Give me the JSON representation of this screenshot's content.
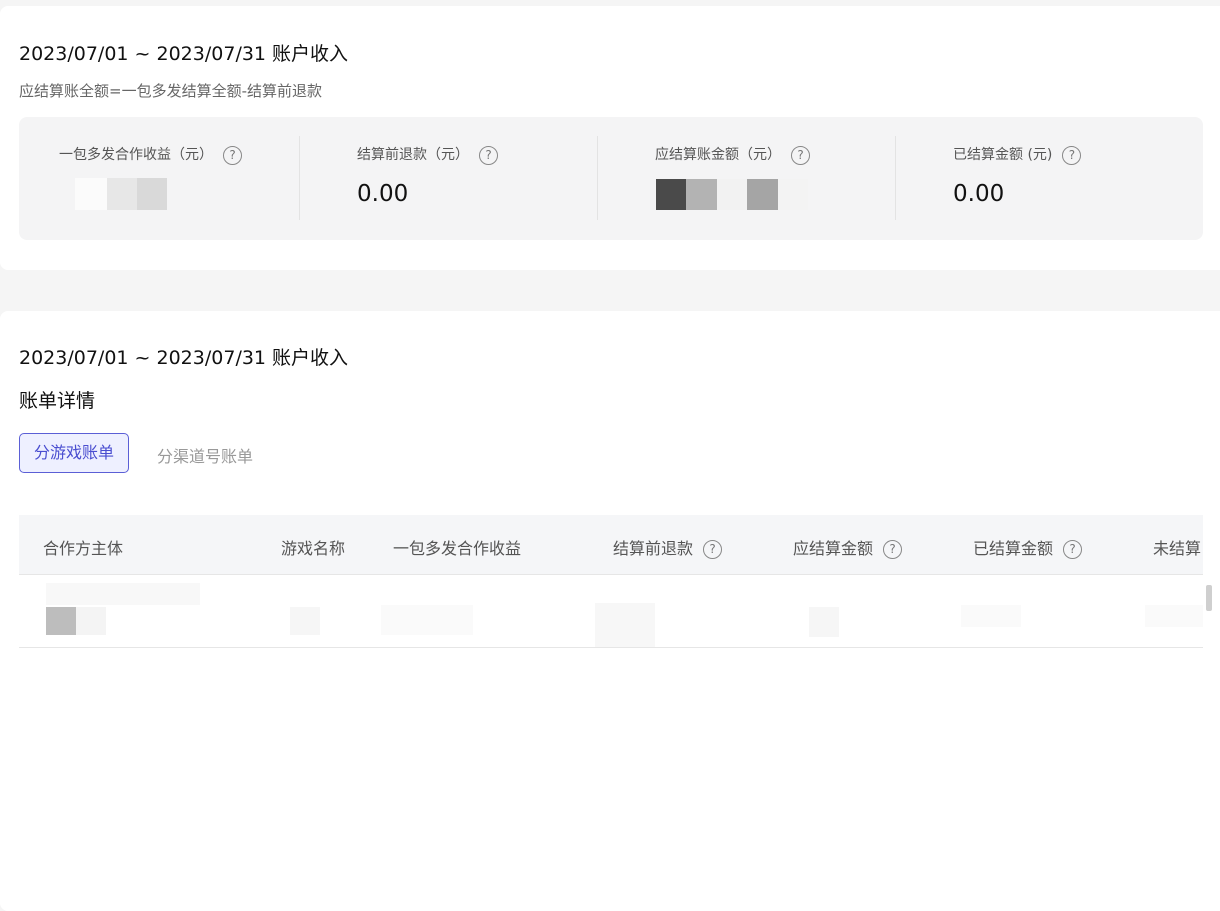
{
  "summary": {
    "title": "2023/07/01 ~ 2023/07/31 账户收入",
    "formula": "应结算账全额=一包多发结算全额-结算前退款",
    "stats": [
      {
        "label": "一包多发合作收益（元）",
        "value": ""
      },
      {
        "label": "结算前退款（元）",
        "value": "0.00"
      },
      {
        "label": "应结算账金额（元）",
        "value": ""
      },
      {
        "label": "已结算金额 (元)",
        "value": "0.00"
      }
    ]
  },
  "detail": {
    "title": "2023/07/01 ~ 2023/07/31 账户收入",
    "bill_title": "账单详情",
    "tabs": [
      {
        "label": "分游戏账单",
        "active": true
      },
      {
        "label": "分渠道号账单",
        "active": false
      }
    ],
    "columns": [
      "合作方主体",
      "游戏名称",
      "一包多发合作收益",
      "结算前退款",
      "应结算金额",
      "已结算金额",
      "未结算"
    ]
  },
  "icons": {
    "help": "question-circle-icon"
  },
  "colors": {
    "accent": "#5b5fd6",
    "accent_bg": "#eef0ff",
    "panel_bg": "#f4f4f5"
  }
}
